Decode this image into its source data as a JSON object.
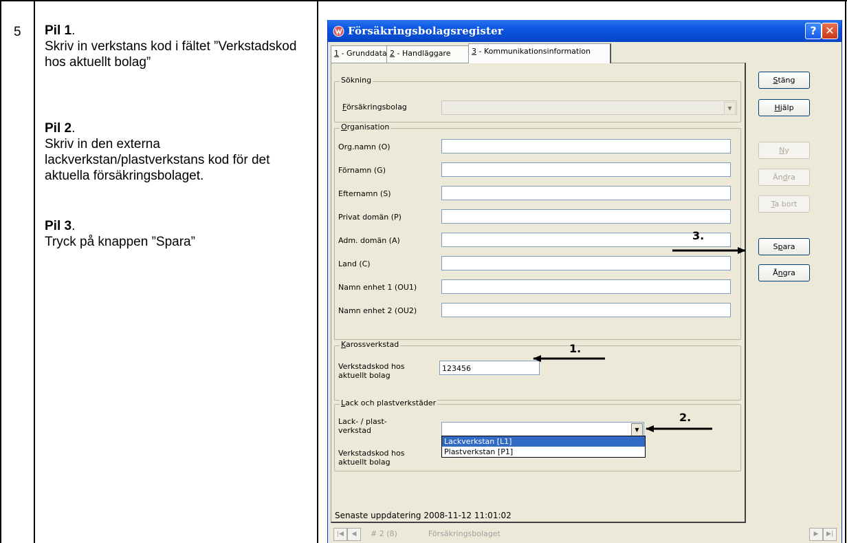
{
  "step": {
    "number": "5"
  },
  "instructions": [
    {
      "head": "Pil 1",
      "text": "Skriv in verkstans kod i fältet ”Verkstadskod hos aktuellt bolag”"
    },
    {
      "head": "Pil 2",
      "text": "Skriv in den externa lackverkstan/plastverkstans kod för det aktuella försäkringsbolaget."
    },
    {
      "head": "Pil 3",
      "text": "Tryck på knappen ”Spara”"
    }
  ],
  "window": {
    "title": "Försäkringsbolagsregister",
    "help_glyph": "?",
    "close_glyph": "✕"
  },
  "tabs": [
    {
      "key": "1",
      "label": " - Grunddata"
    },
    {
      "key": "2",
      "label": " - Handläggare"
    },
    {
      "key": "3",
      "label": " - Kommunikationsinformation"
    }
  ],
  "search_group": {
    "title": "Sökning",
    "field_label_key": "F",
    "field_label": "örsäkringsbolag",
    "value": ""
  },
  "org_group": {
    "title_key": "O",
    "title": "rganisation",
    "fields": [
      {
        "label": "Org.namn (O)",
        "value": ""
      },
      {
        "label": "Förnamn (G)",
        "value": ""
      },
      {
        "label": "Efternamn (S)",
        "value": ""
      },
      {
        "label": "Privat domän (P)",
        "value": ""
      },
      {
        "label": "Adm. domän (A)",
        "value": ""
      },
      {
        "label": "Land (C)",
        "value": ""
      },
      {
        "label": "Namn enhet 1 (OU1)",
        "value": ""
      },
      {
        "label": "Namn enhet 2 (OU2)",
        "value": ""
      }
    ]
  },
  "kaross_group": {
    "title_key": "K",
    "title": "arossverkstad",
    "label": "Verkstadskod hos aktuellt bolag",
    "value": "123456"
  },
  "lack_group": {
    "title_key": "L",
    "title": "ack och plastverkstäder",
    "type_label": "Lack- / plast- verkstad",
    "code_label": "Verkstadskod hos aktuellt bolag",
    "type_value": "",
    "options": [
      "Lackverkstan [L1]",
      "Plastverkstan [P1]"
    ],
    "highlighted_option": "Lackverkstan [L1]"
  },
  "side_buttons": {
    "close": {
      "pre": "",
      "key": "S",
      "post": "täng",
      "enabled": true
    },
    "help": {
      "pre": "",
      "key": "H",
      "post": "jälp",
      "enabled": true
    },
    "new": {
      "pre": "",
      "key": "N",
      "post": "y",
      "enabled": false
    },
    "edit": {
      "pre": "Än",
      "key": "d",
      "post": "ra",
      "enabled": false
    },
    "delete": {
      "pre": "",
      "key": "T",
      "post": "a bort",
      "enabled": false
    },
    "save": {
      "pre": "S",
      "key": "p",
      "post": "ara",
      "enabled": true
    },
    "undo": {
      "pre": "Å",
      "key": "n",
      "post": "gra",
      "enabled": true
    }
  },
  "status": {
    "text": "Senaste uppdatering   2008-11-12 11:01:02"
  },
  "nav": {
    "record": "# 2 (8)",
    "entity": "Försäkringsbolaget"
  },
  "annotations": {
    "arrow1": "1.",
    "arrow2": "2.",
    "arrow3": "3."
  },
  "colors": {
    "titlebar": "#0a55e0",
    "selection": "#316ac5",
    "window_bg": "#ece9d8"
  }
}
